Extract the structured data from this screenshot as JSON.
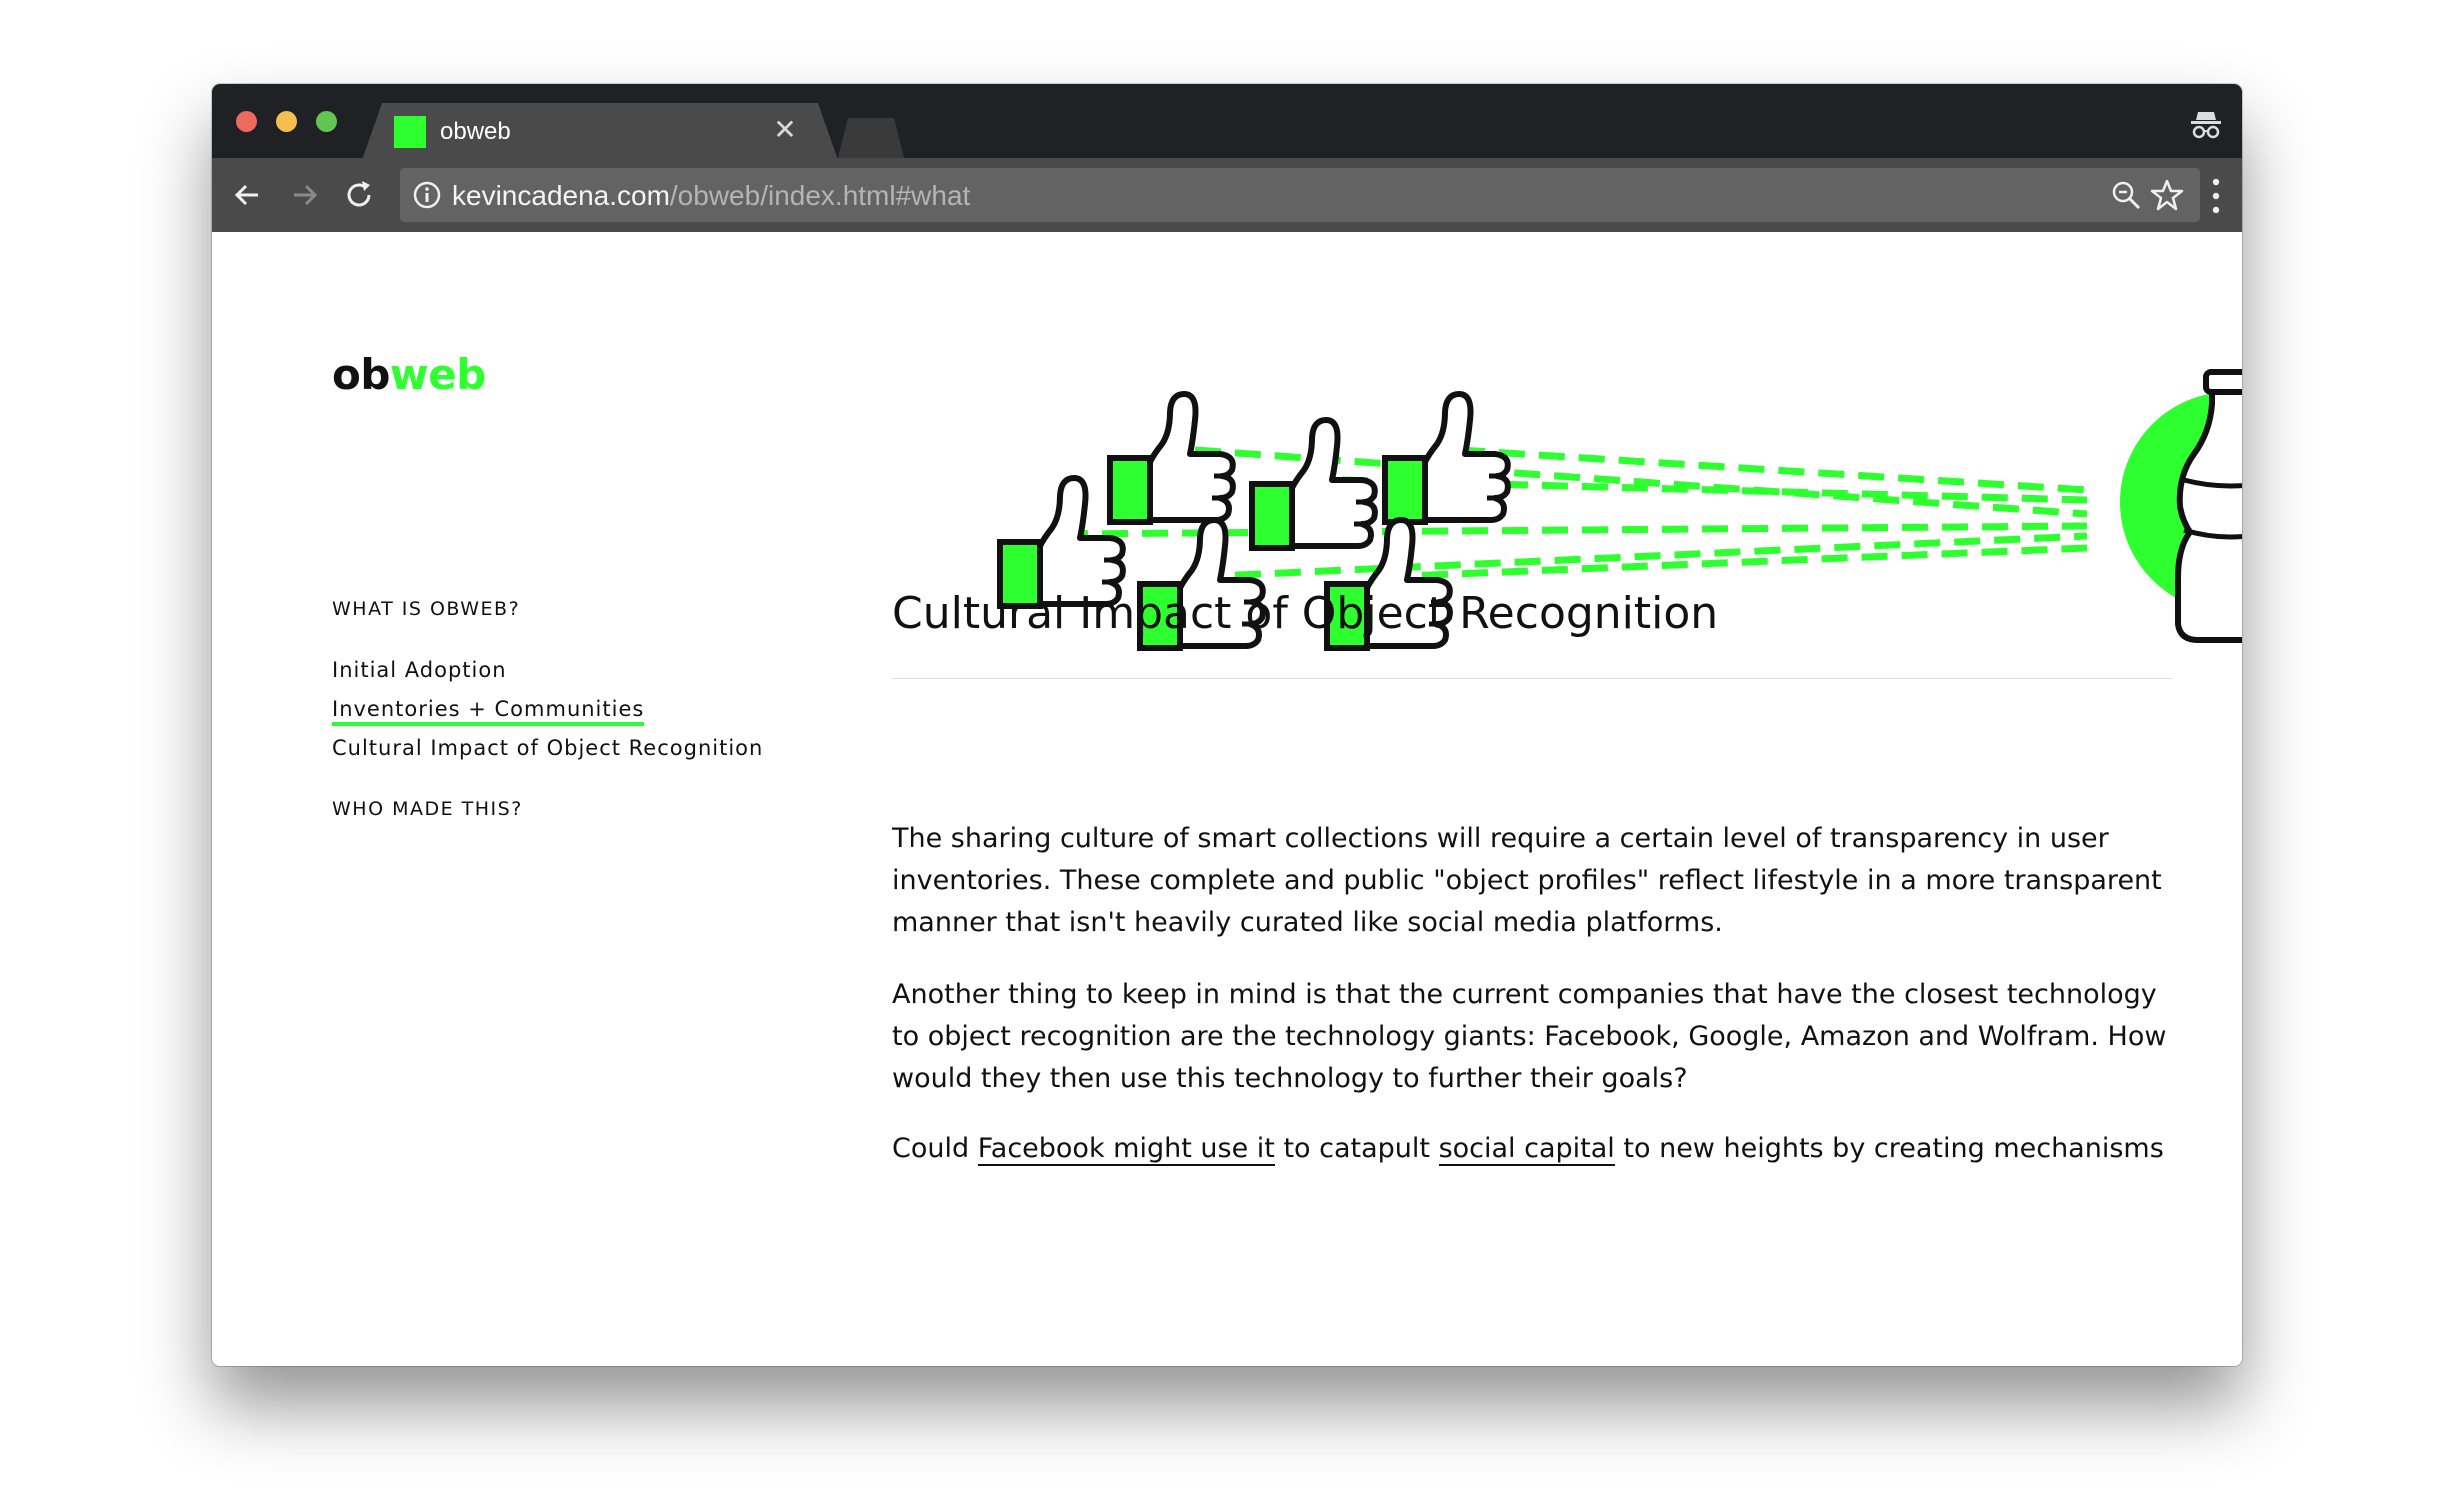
{
  "browser": {
    "tab_title": "obweb",
    "url_domain": "kevincadena.com",
    "url_path": "/obweb/index.html#what",
    "favicon_color": "#2eff2e",
    "icons": [
      "close-icon",
      "back-arrow-icon",
      "forward-arrow-icon",
      "reload-icon",
      "info-icon",
      "zoom-icon",
      "star-icon",
      "menu-dots-icon",
      "incognito-icon"
    ]
  },
  "site": {
    "logo_part1": "ob",
    "logo_part2": "web",
    "accent_color": "#2eff2e"
  },
  "hero": {
    "icons": [
      "thumbs-up-icon",
      "bottle-icon"
    ]
  },
  "nav": {
    "what_heading": "WHAT IS OBWEB?",
    "links": [
      "Initial Adoption",
      "Inventories + Communities",
      "Cultural Impact of Object Recognition"
    ],
    "active_link": "Inventories + Communities",
    "who_heading": "WHO MADE THIS?"
  },
  "article": {
    "title": "Cultural Impact of Object Recognition",
    "paragraphs": [
      "The sharing culture of smart collections will require a certain level of transparency in user inventories. These complete and public \"object profiles\" reflect lifestyle in a more transparent manner that isn't heavily curated like social media platforms.",
      "Another thing to keep in mind is that the current companies that have the closest technology to object recognition are the technology giants: Facebook, Google, Amazon and Wolfram. How would they then use this technology to further their goals?"
    ],
    "p3_start": "Could ",
    "p3_link1": "Facebook might use it",
    "p3_mid": " to catapult ",
    "p3_link2": "social capital",
    "p3_end": " to new heights by creating mechanisms"
  }
}
